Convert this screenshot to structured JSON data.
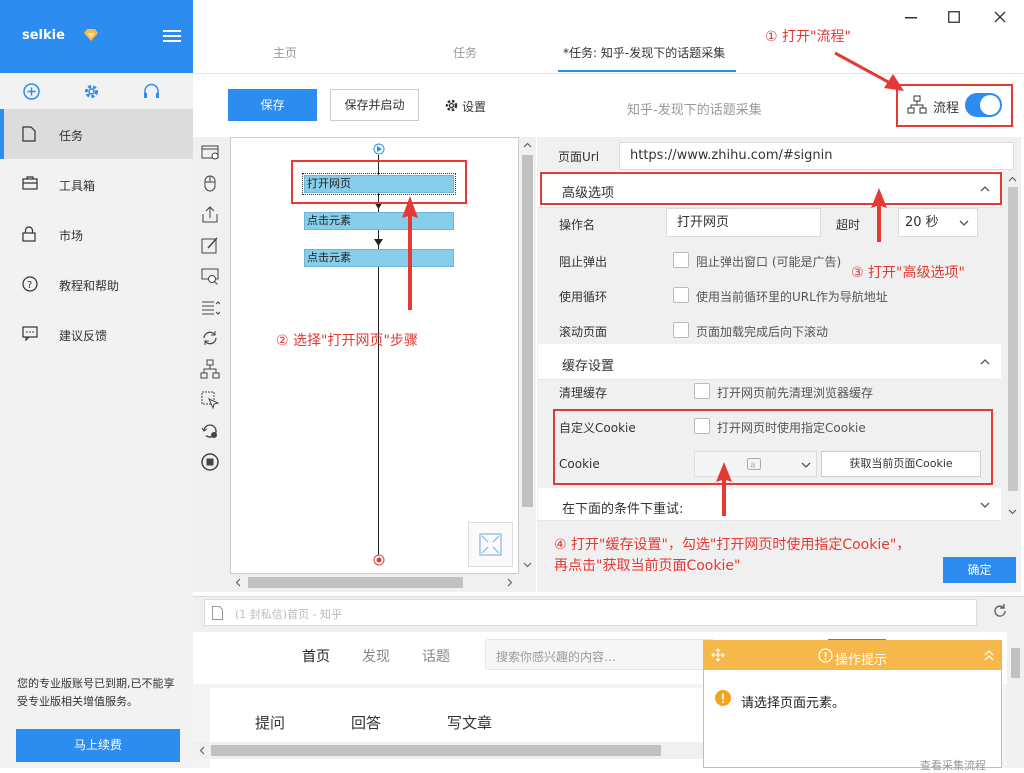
{
  "app": {
    "name": "selkie"
  },
  "sidebar": {
    "items": [
      {
        "label": "任务"
      },
      {
        "label": "工具箱"
      },
      {
        "label": "市场"
      },
      {
        "label": "教程和帮助"
      },
      {
        "label": "建议反馈"
      }
    ],
    "notice": "您的专业版账号已到期,已不能享受专业版相关增值服务。",
    "renew_label": "马上续费"
  },
  "tabs": [
    "主页",
    "任务",
    "*任务: 知乎-发现下的话题采集"
  ],
  "toolbar": {
    "save": "保存",
    "save_start": "保存并启动",
    "settings": "设置",
    "task_title": "知乎-发现下的话题采集",
    "flow_label": "流程"
  },
  "flow": {
    "steps": [
      "打开网页",
      "点击元素",
      "点击元素"
    ]
  },
  "panel": {
    "url_label": "页面Url",
    "url_value": "https://www.zhihu.com/#signin",
    "advanced_title": "高级选项",
    "op_name_label": "操作名",
    "op_name_value": "打开网页",
    "timeout_label": "超时",
    "timeout_value": "20 秒",
    "popup_label": "阻止弹出",
    "popup_cb": "阻止弹出窗口 (可能是广告)",
    "loop_label": "使用循环",
    "loop_cb": "使用当前循环里的URL作为导航地址",
    "scroll_label": "滚动页面",
    "scroll_cb": "页面加载完成后向下滚动",
    "cache_title": "缓存设置",
    "clear_label": "清理缓存",
    "clear_cb": "打开网页前先清理浏览器缓存",
    "cookie_custom_label": "自定义Cookie",
    "cookie_custom_cb": "打开网页时使用指定Cookie",
    "cookie_label": "Cookie",
    "get_cookie": "获取当前页面Cookie",
    "retry_title": "在下面的条件下重试:",
    "ok": "确定"
  },
  "annotations": {
    "a1": "① 打开\"流程\"",
    "a2": "② 选择\"打开网页\"步骤",
    "a3": "③ 打开\"高级选项\"",
    "a4_line1": "④ 打开\"缓存设置\"，勾选\"打开网页时使用指定Cookie\"，",
    "a4_line2": "再点击\"获取当前页面Cookie\""
  },
  "browser": {
    "address": "(1 封私信)首页 - 知乎",
    "nav": [
      "首页",
      "发现",
      "话题"
    ],
    "search_placeholder": "搜索你感兴趣的内容…",
    "actions": [
      "提问",
      "回答",
      "写文章"
    ]
  },
  "tip": {
    "title": "操作提示",
    "message": "请选择页面元素。",
    "footer": "查看采集流程"
  },
  "colors": {
    "accent": "#2d8cf0",
    "annotation": "#e53935",
    "tip": "#f7b84b"
  }
}
